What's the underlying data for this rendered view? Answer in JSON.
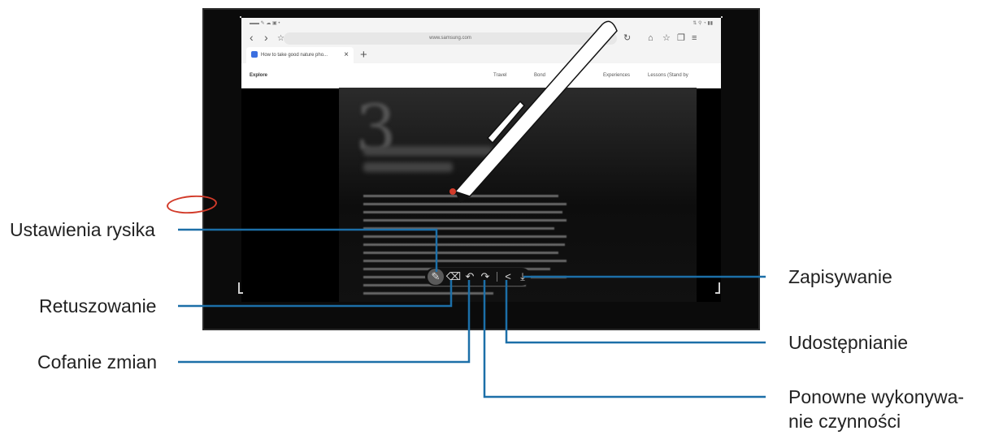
{
  "callouts": {
    "pen_settings": "Ustawienia rysika",
    "retouch": "Retuszowanie",
    "undo": "Cofanie zmian",
    "save": "Zapisywanie",
    "share": "Udostępnianie",
    "redo_line1": "Ponowne wykonywa-",
    "redo_line2": "nie czynności"
  },
  "browser": {
    "url": "www.samsung.com",
    "tab_title": "How to take good nature pho...",
    "site_logo": "Explore",
    "site_nav": [
      "Travel",
      "Bond",
      "Experiences",
      "Lessons (Stand by"
    ]
  },
  "toolbar": {
    "buttons": [
      "pen-settings",
      "eraser",
      "undo",
      "redo",
      "share",
      "save"
    ]
  },
  "colors": {
    "annotation_red": "#d23b2a",
    "leader_line": "#1c6fa8"
  }
}
